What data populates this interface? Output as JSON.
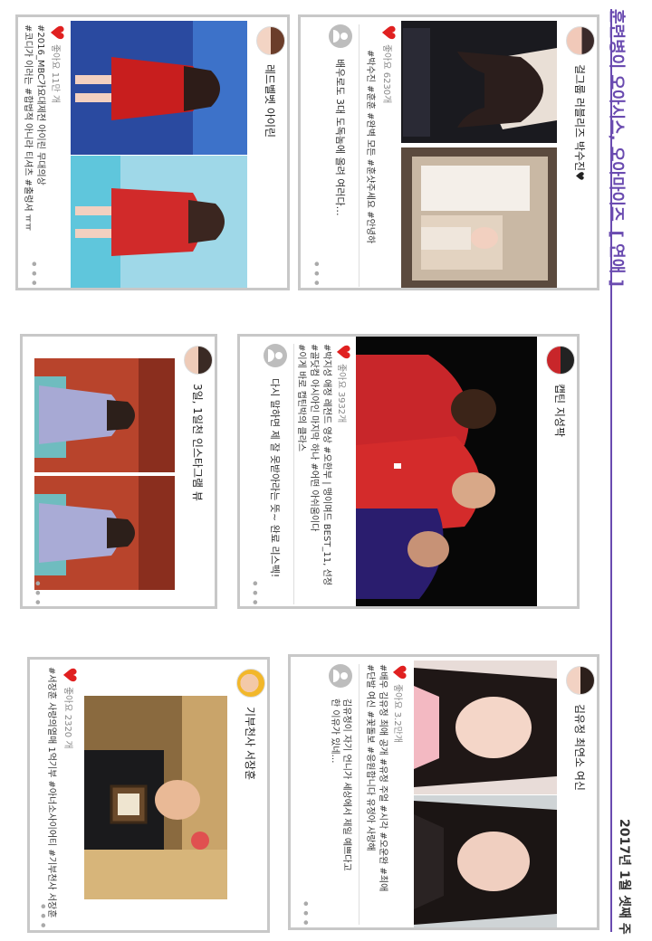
{
  "header": {
    "title_main": "훈련병이 오아시스, 오아마이즈",
    "bracket_open": "[",
    "section": "연애",
    "bracket_close": "]",
    "date": "2017년 1월 셋째 주"
  },
  "colors": {
    "accent": "#6a4bb0",
    "heart": "#e02020",
    "border": "#c8c8c8"
  },
  "posts": [
    {
      "username": "걸그룹 러블리즈 박수진♥",
      "likes": "좋아요 6230개",
      "tags": "#박수진 #훈훈 #완벽 모든 #훈샷주세요 #안녕하",
      "comment": "배우로도 3대 도독놈에 올려 여러다…",
      "more": "•••",
      "heart_icon": "heart-icon"
    },
    {
      "username": "레드벨벳 아이린",
      "likes": "좋아요 11만 개",
      "tags": "#2016_MBC가요대제전 아이린 무대의상\n#코디가 이러는 #합법적 아니라 티셔츠 #출렁셔 ㅠㅠ",
      "comment": "",
      "more": "•••"
    },
    {
      "username": "캡틴 지성팍",
      "likes": "좋아요 3932개",
      "tags": "#박지성 애정 레전드 영상 #오한부 | 맹이며드 BEST_11, 선정\n#골닷컴 아시아인 마지막 하나 #어떤 아쉬움이다\n#이게 바로 캡틴박의 클라스",
      "comment": "다시 말하면 제 잘 못받아라는 뜻~ 완료 리스펙!",
      "more": "•••"
    },
    {
      "username": "3일, 1일천 인스타그램 뷰",
      "likes": "",
      "tags": "",
      "comment": "",
      "more": "•••"
    },
    {
      "username": "김유정 최연소 여신",
      "likes": "좋아요 3.2만개",
      "tags": "#배우 김유정 최애 공개 #유정 주얼 #시각 #오운완 #최애\n#단발 여신 #꽃돌보 #응원합니다 유정아 사랑해",
      "comment": "김유정이 자기 언니가 세상에서 제일 예쁘다고\n한 이유가 있네…",
      "more": "•••"
    },
    {
      "username": "기부천사 서장훈",
      "likes": "좋아요 2320 개",
      "tags": "#서장훈 사랑의열매 1억기부 #아너소사이어티 #기부천사 서장훈",
      "comment": "",
      "more": "•••"
    }
  ]
}
